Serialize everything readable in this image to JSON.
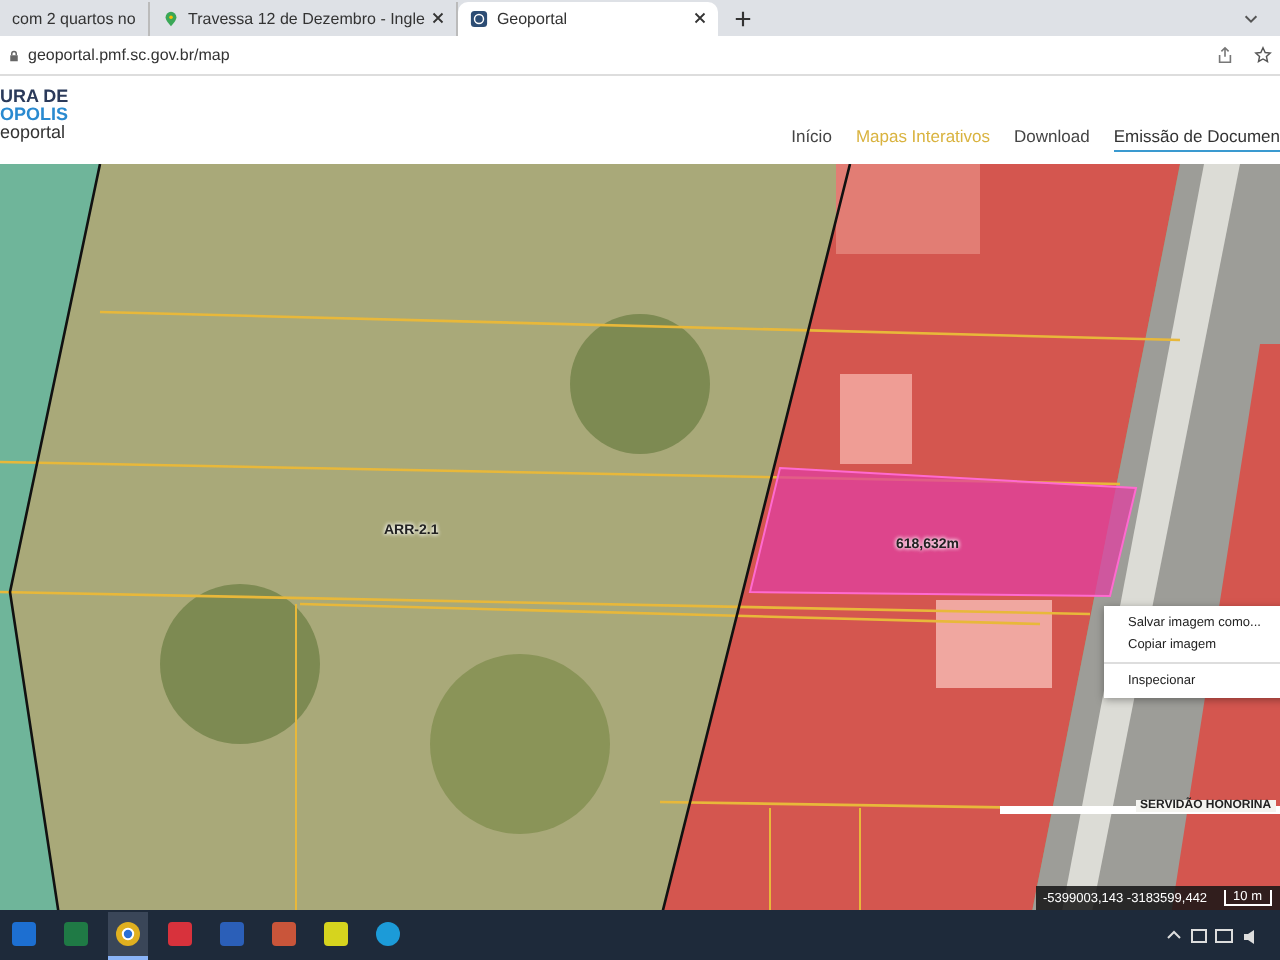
{
  "browser": {
    "tabs": [
      {
        "title": "com 2 quartos no",
        "selected": false,
        "kind": "page"
      },
      {
        "title": "Travessa 12 de Dezembro - Ingle",
        "selected": false,
        "kind": "maps"
      },
      {
        "title": "Geoportal",
        "selected": true,
        "kind": "geo"
      }
    ],
    "address": "geoportal.pmf.sc.gov.br/map"
  },
  "header": {
    "logo_lines": [
      "URA DE",
      "OPOLIS",
      "eoportal"
    ],
    "nav": [
      {
        "label": "Início",
        "selected": false,
        "hover": false
      },
      {
        "label": "Mapas Interativos",
        "selected": false,
        "hover": true
      },
      {
        "label": "Download",
        "selected": false,
        "hover": false
      },
      {
        "label": "Emissão de Documen",
        "selected": true,
        "hover": false
      }
    ]
  },
  "map": {
    "zone_label": "ARR-2.1",
    "measure": "618,632m",
    "street": "SERVIDÃO HONORINA",
    "coordinates": "-5399003,143 -3183599,442",
    "scale": "10 m"
  },
  "context_menu": {
    "items": [
      {
        "label": "Salvar imagem como...",
        "kind": "item"
      },
      {
        "label": "Copiar imagem",
        "kind": "item"
      },
      {
        "label": "Inspecionar",
        "kind": "separated"
      }
    ]
  },
  "taskbar": {
    "apps": [
      {
        "kind": "store",
        "selected": false
      },
      {
        "kind": "excel",
        "selected": false
      },
      {
        "kind": "chrome",
        "selected": true
      },
      {
        "kind": "red",
        "selected": false
      },
      {
        "kind": "word",
        "selected": false
      },
      {
        "kind": "paint",
        "selected": false
      },
      {
        "kind": "yellow",
        "selected": false
      },
      {
        "kind": "edge",
        "selected": false
      }
    ]
  }
}
